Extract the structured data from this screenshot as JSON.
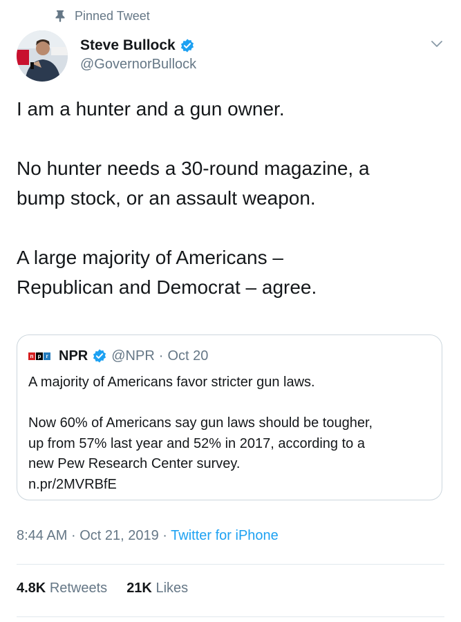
{
  "pinned": {
    "label": "Pinned Tweet",
    "icon": "pin-icon"
  },
  "author": {
    "name": "Steve Bullock",
    "handle": "@GovernorBullock",
    "verified": true
  },
  "tweet": {
    "paragraphs": [
      [
        "I am a hunter and a gun owner."
      ],
      [
        "No hunter needs a 30-round magazine, a",
        "bump stock, or an assault weapon."
      ],
      [
        "A large majority of Americans –",
        "Republican and Democrat – agree."
      ]
    ]
  },
  "quote": {
    "name": "NPR",
    "handle": "@NPR",
    "separator": "·",
    "date": "Oct 20",
    "logo_letters": [
      "n",
      "p",
      "r"
    ],
    "paragraphs": [
      [
        "A majority of Americans favor stricter gun laws."
      ],
      [
        "Now 60% of Americans say gun laws should be tougher,",
        "up from 57% last year and 52% in 2017, according to a",
        "new Pew Research Center survey.",
        "n.pr/2MVRBfE"
      ]
    ]
  },
  "meta": {
    "time": "8:44 AM",
    "separator": "·",
    "date": "Oct 21, 2019",
    "source": "Twitter for iPhone"
  },
  "stats": {
    "retweets_count": "4.8K",
    "retweets_label": "Retweets",
    "likes_count": "21K",
    "likes_label": "Likes"
  },
  "colors": {
    "accent": "#1da1f2",
    "secondary_text": "#657786",
    "border": "#ccd6dd"
  }
}
